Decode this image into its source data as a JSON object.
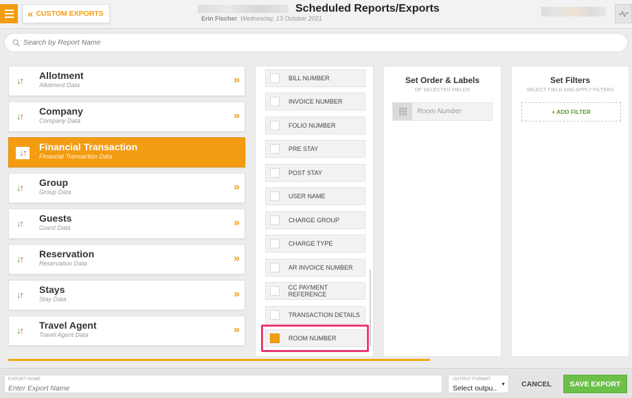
{
  "header": {
    "back_label": "CUSTOM EXPORTS",
    "title": "Scheduled Reports/Exports",
    "user": "Erin Fischer",
    "date": "Wednesday, 13 October 2021"
  },
  "search": {
    "placeholder": "Search by Report Name"
  },
  "categories": [
    {
      "title": "Allotment",
      "subtitle": "Allotment Data",
      "active": false
    },
    {
      "title": "Company",
      "subtitle": "Company Data",
      "active": false
    },
    {
      "title": "Financial Transaction",
      "subtitle": "Financial Transaction Data",
      "active": true
    },
    {
      "title": "Group",
      "subtitle": "Group Data",
      "active": false
    },
    {
      "title": "Guests",
      "subtitle": "Guest Data",
      "active": false
    },
    {
      "title": "Reservation",
      "subtitle": "Reservation Data",
      "active": false
    },
    {
      "title": "Stays",
      "subtitle": "Stay Data",
      "active": false
    },
    {
      "title": "Travel Agent",
      "subtitle": "Travel Agent Data",
      "active": false
    }
  ],
  "fields": [
    {
      "label": "BILL NUMBER",
      "checked": false
    },
    {
      "label": "INVOICE NUMBER",
      "checked": false
    },
    {
      "label": "FOLIO NUMBER",
      "checked": false
    },
    {
      "label": "PRE STAY",
      "checked": false
    },
    {
      "label": "POST STAY",
      "checked": false
    },
    {
      "label": "USER NAME",
      "checked": false
    },
    {
      "label": "CHARGE GROUP",
      "checked": false
    },
    {
      "label": "CHARGE TYPE",
      "checked": false
    },
    {
      "label": "AR INVOICE NUMBER",
      "checked": false
    },
    {
      "label": "CC PAYMENT REFERENCE",
      "checked": false
    },
    {
      "label": "TRANSACTION DETAILS",
      "checked": false
    },
    {
      "label": "ROOM NUMBER",
      "checked": true
    }
  ],
  "order": {
    "title": "Set Order & Labels",
    "subtitle": "OF SELECTED FIELDS",
    "items": [
      "Room Number"
    ]
  },
  "filters": {
    "title": "Set Filters",
    "subtitle": "SELECT FIELD AND APPLY FILTERS",
    "add_label": "+ ADD FILTER"
  },
  "progress": {
    "fraction": 1.0
  },
  "footer": {
    "name_caption": "EXPORT NAME",
    "name_placeholder": "Enter Export Name",
    "format_caption": "OUTPUT FORMAT",
    "format_value": "Select outpu..",
    "cancel_label": "CANCEL",
    "save_label": "SAVE EXPORT"
  },
  "colors": {
    "accent": "#f39c12",
    "success": "#6cc048",
    "highlight": "#e83a72"
  },
  "icons": [
    "menu-icon",
    "double-chevron-left-icon",
    "activity-icon",
    "search-icon",
    "sort-arrows-icon",
    "double-chevron-right-icon",
    "drag-grip-icon",
    "caret-down-icon"
  ]
}
